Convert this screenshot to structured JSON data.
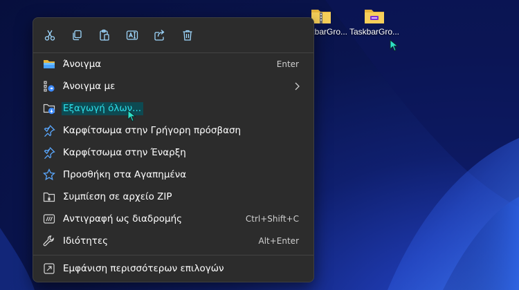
{
  "desktop": {
    "icons": [
      {
        "label": "TaskbarGro...",
        "icon": "zip-folder-icon"
      },
      {
        "label": "TaskbarGro...",
        "icon": "folder-icon"
      }
    ]
  },
  "context_menu": {
    "toolbar": [
      {
        "name": "cut-icon"
      },
      {
        "name": "copy-icon"
      },
      {
        "name": "paste-icon"
      },
      {
        "name": "rename-icon"
      },
      {
        "name": "share-icon"
      },
      {
        "name": "delete-icon"
      }
    ],
    "items": [
      {
        "label": "Άνοιγμα",
        "shortcut": "Enter",
        "icon": "folder-open-icon"
      },
      {
        "label": "Άνοιγμα με",
        "icon": "open-with-icon",
        "submenu": true
      },
      {
        "label": "Εξαγωγή όλων...",
        "icon": "extract-all-icon"
      },
      {
        "label": "Καρφίτσωμα στην Γρήγορη πρόσβαση",
        "icon": "pin-icon"
      },
      {
        "label": "Καρφίτσωμα στην Έναρξη",
        "icon": "pin-icon"
      },
      {
        "label": "Προσθήκη στα Αγαπημένα",
        "icon": "star-icon"
      },
      {
        "label": "Συμπίεση σε αρχείο ZIP",
        "icon": "zip-icon"
      },
      {
        "label": "Αντιγραφή ως διαδρομής",
        "shortcut": "Ctrl+Shift+C",
        "icon": "copy-path-icon"
      },
      {
        "label": "Ιδιότητες",
        "shortcut": "Alt+Enter",
        "icon": "wrench-icon"
      },
      {
        "label": "Εμφάνιση περισσότερων επιλογών",
        "icon": "more-options-icon"
      }
    ]
  },
  "colors": {
    "menu_bg": "#2c2c2c",
    "accent": "#60cdff",
    "highlight_text": "#2de0ea",
    "highlight_bg": "#0d4a52"
  }
}
